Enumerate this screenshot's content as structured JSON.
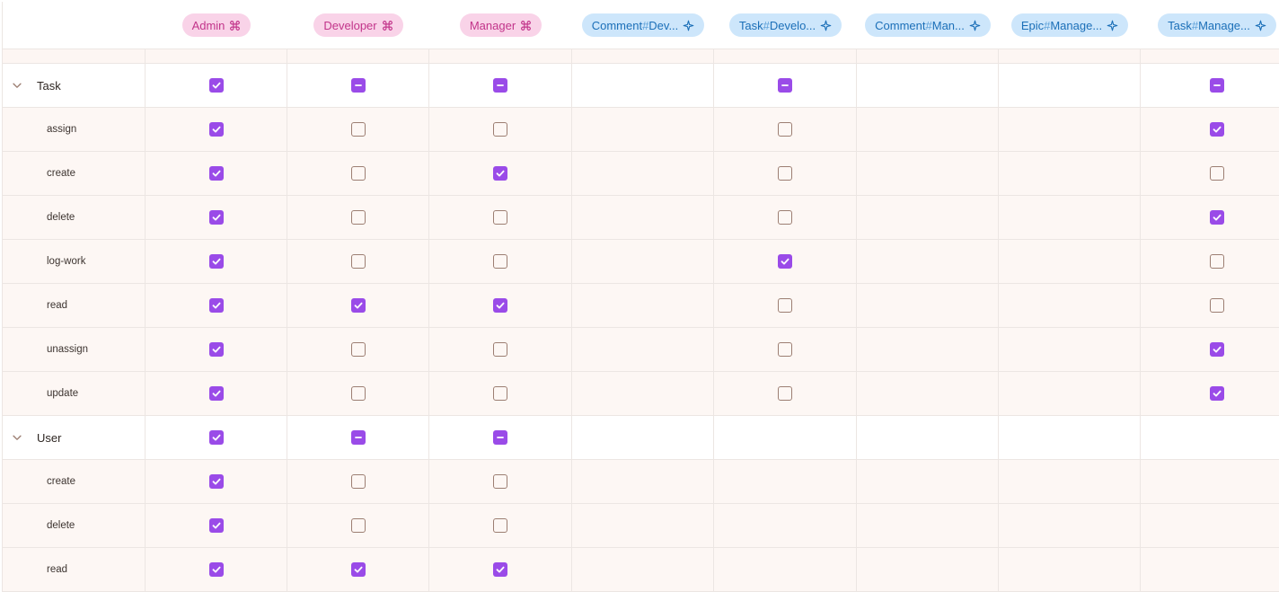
{
  "columns": [
    {
      "kind": "role",
      "pre": "Admin",
      "hash": "",
      "post": "",
      "icon": "command-icon"
    },
    {
      "kind": "role",
      "pre": "Developer",
      "hash": "",
      "post": "",
      "icon": "command-icon"
    },
    {
      "kind": "role",
      "pre": "Manager",
      "hash": "",
      "post": "",
      "icon": "command-icon"
    },
    {
      "kind": "scope",
      "pre": "Comment",
      "hash": "#",
      "post": "Dev...",
      "icon": "sparkle-icon"
    },
    {
      "kind": "scope",
      "pre": "Task",
      "hash": "#",
      "post": "Develo...",
      "icon": "sparkle-icon"
    },
    {
      "kind": "scope",
      "pre": "Comment",
      "hash": "#",
      "post": "Man...",
      "icon": "sparkle-icon"
    },
    {
      "kind": "scope",
      "pre": "Epic",
      "hash": "#",
      "post": "Manage...",
      "icon": "sparkle-icon"
    },
    {
      "kind": "scope",
      "pre": "Task",
      "hash": "#",
      "post": "Manage...",
      "icon": "sparkle-icon"
    }
  ],
  "groups": [
    {
      "label": "Task",
      "expand_icon": "chevron-down-icon",
      "states": [
        "on",
        "partial",
        "partial",
        "",
        "partial",
        "",
        "",
        "partial"
      ],
      "permissions": [
        {
          "label": "assign",
          "states": [
            "on",
            "off",
            "off",
            "",
            "off",
            "",
            "",
            "on"
          ]
        },
        {
          "label": "create",
          "states": [
            "on",
            "off",
            "on",
            "",
            "off",
            "",
            "",
            "off"
          ]
        },
        {
          "label": "delete",
          "states": [
            "on",
            "off",
            "off",
            "",
            "off",
            "",
            "",
            "on"
          ]
        },
        {
          "label": "log-work",
          "states": [
            "on",
            "off",
            "off",
            "",
            "on",
            "",
            "",
            "off"
          ]
        },
        {
          "label": "read",
          "states": [
            "on",
            "on",
            "on",
            "",
            "off",
            "",
            "",
            "off"
          ]
        },
        {
          "label": "unassign",
          "states": [
            "on",
            "off",
            "off",
            "",
            "off",
            "",
            "",
            "on"
          ]
        },
        {
          "label": "update",
          "states": [
            "on",
            "off",
            "off",
            "",
            "off",
            "",
            "",
            "on"
          ]
        }
      ]
    },
    {
      "label": "User",
      "expand_icon": "chevron-down-icon",
      "states": [
        "on",
        "partial",
        "partial",
        "",
        "",
        "",
        "",
        ""
      ],
      "permissions": [
        {
          "label": "create",
          "states": [
            "on",
            "off",
            "off",
            "",
            "",
            "",
            "",
            ""
          ]
        },
        {
          "label": "delete",
          "states": [
            "on",
            "off",
            "off",
            "",
            "",
            "",
            "",
            ""
          ]
        },
        {
          "label": "read",
          "states": [
            "on",
            "on",
            "on",
            "",
            "",
            "",
            "",
            ""
          ]
        }
      ]
    }
  ],
  "colors": {
    "checkbox_checked": "#9a4be8",
    "checkbox_unchecked_border": "#9c7e72",
    "role_pill_bg": "#f9d3e8",
    "role_pill_text": "#c2348a",
    "scope_pill_bg": "#cde6fb",
    "scope_pill_text": "#1b6fb8",
    "row_bg": "#fdf7f4"
  }
}
